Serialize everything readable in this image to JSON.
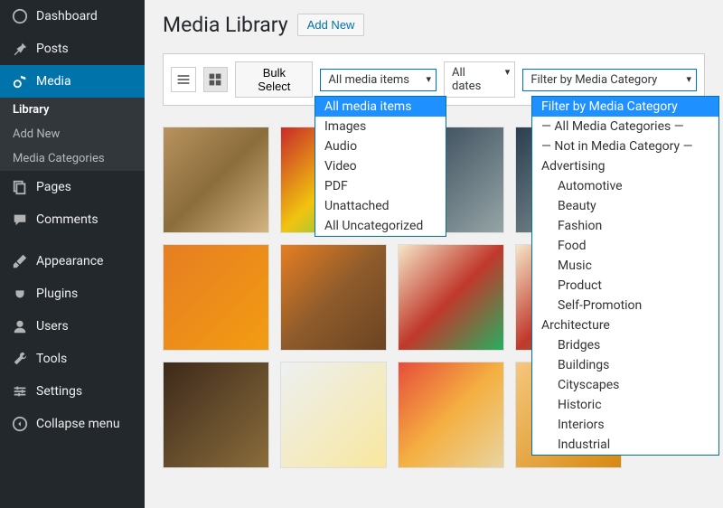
{
  "sidebar": [
    {
      "label": "Dashboard",
      "icon": "dashboard-icon"
    },
    {
      "label": "Posts",
      "icon": "pin-icon"
    },
    {
      "label": "Media",
      "icon": "media-icon",
      "active": true,
      "sub": [
        {
          "label": "Library",
          "active": true
        },
        {
          "label": "Add New"
        },
        {
          "label": "Media Categories"
        }
      ]
    },
    {
      "label": "Pages",
      "icon": "pages-icon"
    },
    {
      "label": "Comments",
      "icon": "comments-icon"
    },
    {
      "gap": true
    },
    {
      "label": "Appearance",
      "icon": "brush-icon"
    },
    {
      "label": "Plugins",
      "icon": "plug-icon"
    },
    {
      "label": "Users",
      "icon": "user-icon"
    },
    {
      "label": "Tools",
      "icon": "wrench-icon"
    },
    {
      "label": "Settings",
      "icon": "settings-icon"
    },
    {
      "label": "Collapse menu",
      "icon": "collapse-icon"
    }
  ],
  "page": {
    "title": "Media Library",
    "add_new": "Add New"
  },
  "toolbar": {
    "bulk_select": "Bulk Select",
    "filter_type": {
      "value": "All media items",
      "options": [
        "All media items",
        "Images",
        "Audio",
        "Video",
        "PDF",
        "Unattached",
        "All Uncategorized"
      ]
    },
    "filter_date": {
      "value": "All dates"
    },
    "filter_category": {
      "value": "Filter by Media Category",
      "options": [
        {
          "label": "Filter by Media Category",
          "selected": true
        },
        {
          "label": "— All Media Categories —"
        },
        {
          "label": "— Not in Media Category —"
        },
        {
          "label": "Advertising"
        },
        {
          "label": "Automotive",
          "indent": true
        },
        {
          "label": "Beauty",
          "indent": true
        },
        {
          "label": "Fashion",
          "indent": true
        },
        {
          "label": "Food",
          "indent": true
        },
        {
          "label": "Music",
          "indent": true
        },
        {
          "label": "Product",
          "indent": true
        },
        {
          "label": "Self-Promotion",
          "indent": true
        },
        {
          "label": "Architecture"
        },
        {
          "label": "Bridges",
          "indent": true
        },
        {
          "label": "Buildings",
          "indent": true
        },
        {
          "label": "Cityscapes",
          "indent": true
        },
        {
          "label": "Historic",
          "indent": true
        },
        {
          "label": "Interiors",
          "indent": true
        },
        {
          "label": "Industrial",
          "indent": true
        }
      ]
    }
  },
  "colors": {
    "accent": "#0073aa",
    "highlight": "#1e90ff"
  }
}
